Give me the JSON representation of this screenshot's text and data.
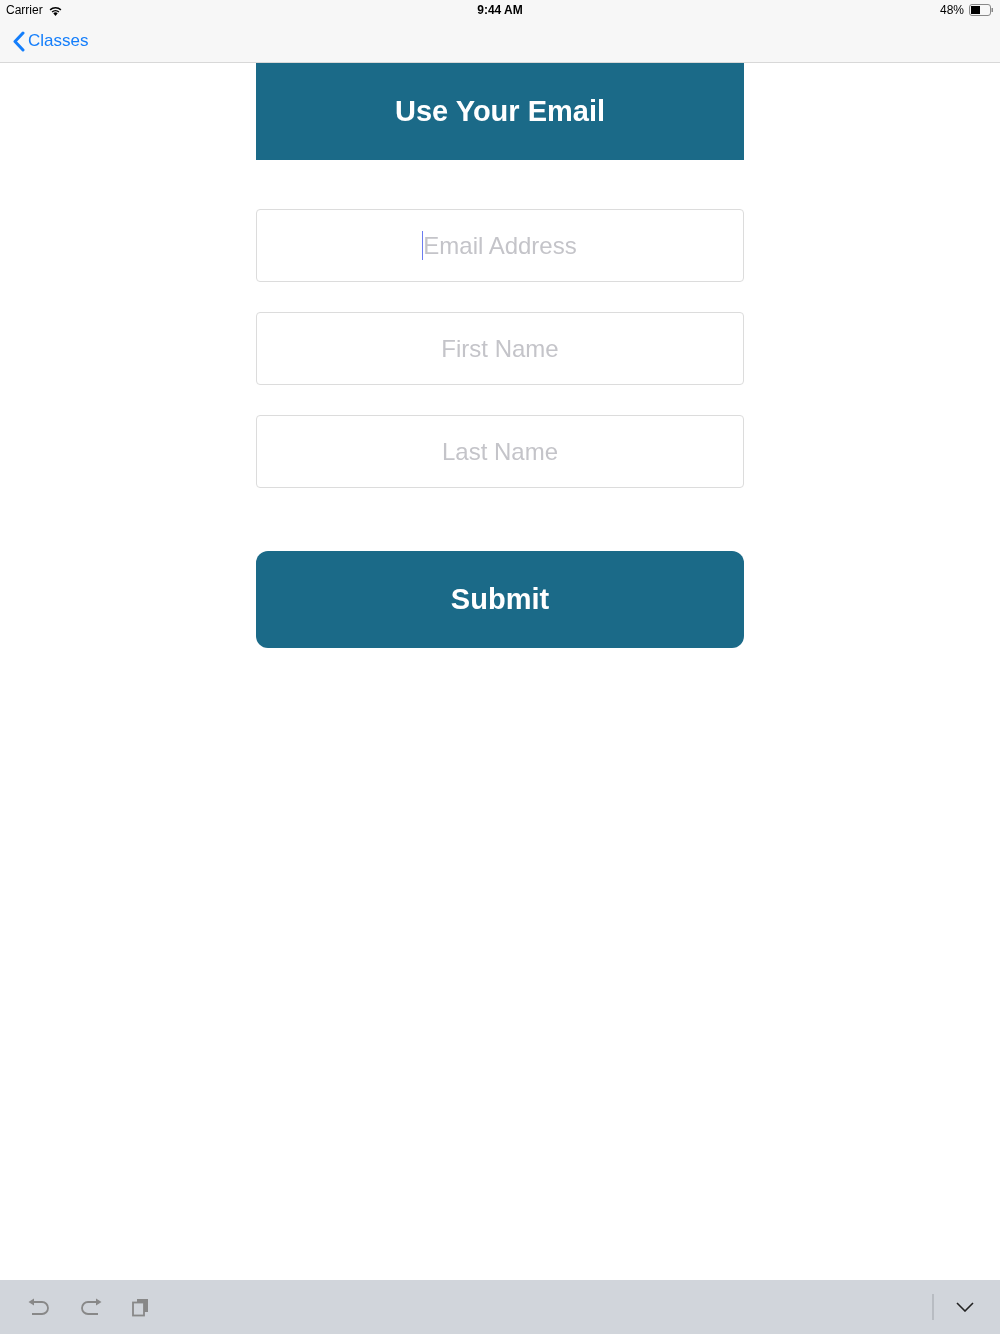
{
  "status_bar": {
    "carrier": "Carrier",
    "time": "9:44 AM",
    "battery": "48%"
  },
  "nav_bar": {
    "back_label": "Classes"
  },
  "header": {
    "title": "Use Your Email"
  },
  "fields": [
    {
      "placeholder": "Email Address",
      "focused": true
    },
    {
      "placeholder": "First Name",
      "focused": false
    },
    {
      "placeholder": "Last Name",
      "focused": false
    }
  ],
  "submit": {
    "label": "Submit"
  }
}
